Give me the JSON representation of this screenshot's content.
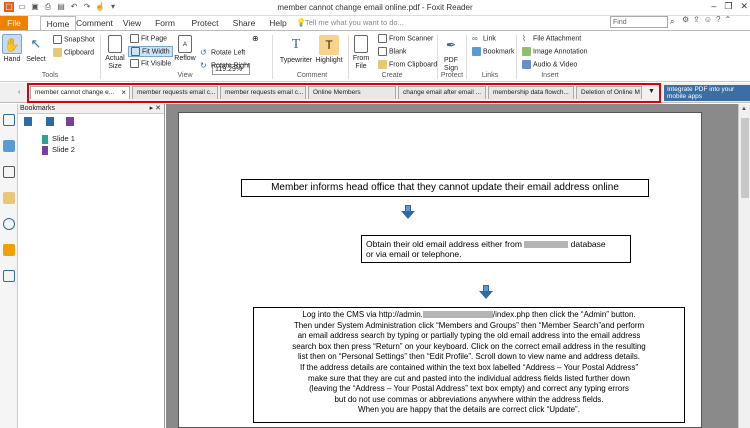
{
  "window": {
    "title": "member cannot change email online.pdf - Foxit Reader",
    "controls": [
      "–",
      "❐",
      "✕"
    ]
  },
  "menu": {
    "items": [
      "File",
      "Home",
      "Comment",
      "View",
      "Form",
      "Protect",
      "Share",
      "Help"
    ],
    "tell_me": "Tell me what you want to do...",
    "find_placeholder": "Find"
  },
  "ribbon": {
    "tools": {
      "hand": "Hand",
      "select": "Select",
      "snapshot": "SnapShot",
      "clipboard": "Clipboard",
      "group": "Tools"
    },
    "view": {
      "actual_size": "Actual Size",
      "fit_page": "Fit Page",
      "fit_width": "Fit Width",
      "fit_visible": "Fit Visible",
      "reflow": "Reflow",
      "zoom": "119.29%",
      "rotate_left": "Rotate Left",
      "rotate_right": "Rotate Right",
      "group": "View"
    },
    "comment": {
      "typewriter": "Typewriter",
      "highlight": "Highlight",
      "group": "Comment"
    },
    "create": {
      "from_file": "From File",
      "from_scanner": "From Scanner",
      "blank": "Blank",
      "from_clipboard": "From Clipboard",
      "group": "Create"
    },
    "protect": {
      "pdf_sign": "PDF Sign",
      "group": "Protect"
    },
    "links": {
      "link": "Link",
      "bookmark": "Bookmark",
      "group": "Links"
    },
    "insert": {
      "file_attachment": "File Attachment",
      "image_annotation": "Image Annotation",
      "audio_video": "Audio & Video",
      "group": "Insert"
    }
  },
  "tabs": [
    "member cannot change e...",
    "member requests email c...",
    "member requests email c...",
    "Online Members",
    "change email after email ...",
    "membership data flowch...",
    "Deletion of Online M"
  ],
  "promo": "Integrate PDF into your mobile apps",
  "bookmarks": {
    "header": "Bookmarks",
    "items": [
      "Slide 1",
      "Slide 2"
    ]
  },
  "document": {
    "box1": "Member informs head office that they cannot update their email address online",
    "box2_line1_a": "Obtain their old email address either from",
    "box2_line1_b": "database",
    "box2_line2": "or via email or telephone.",
    "box3_l1_a": "Log into the CMS via http://admin.",
    "box3_l1_b": "/index.php then click the “Admin” button.",
    "box3_lines": [
      "Then under System Administration click “Members and Groups” then “Member Search”and perform",
      "an email address search by typing or partially typing the old email address into the email address",
      "search box then press “Return” on your keyboard. Click on the correct email address in the resulting",
      "list then on “Personal Settings” then “Edit Profile”. Scroll down to view name and address details.",
      "If the address details are contained within the text box labelled “Address – Your Postal Address”",
      "make sure that they are cut and pasted into the individual address fields listed further down",
      "(leaving the “Address – Your Postal Address” text box empty) and correct any typing errors",
      "but do not use commas or abbreviations anywhere within the address fields.",
      "When you are happy that the details are correct click “Update”."
    ]
  },
  "colors": {
    "file_tab": "#f08000",
    "tab_highlight": "#dd0000",
    "arrow": "#5b9bd5"
  }
}
